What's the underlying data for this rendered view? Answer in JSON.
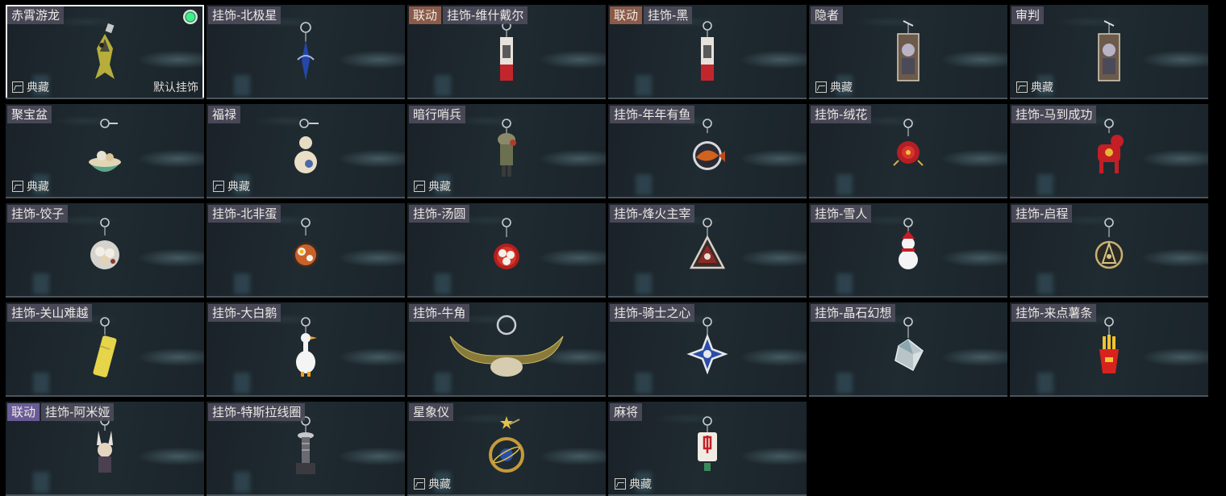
{
  "collection_label": "典藏",
  "default_label": "默认挂饰",
  "items": [
    {
      "tag": "",
      "name": "赤霄游龙",
      "collection": true,
      "selected": true,
      "default": true,
      "icon": "dragon-figure-icon"
    },
    {
      "tag": "",
      "name": "挂饰-北极星",
      "collection": false,
      "icon": "polaris-star-icon"
    },
    {
      "tag": "联动",
      "name": "挂饰-维什戴尔",
      "collection": false,
      "icon": "red-tag-charm-icon"
    },
    {
      "tag": "联动",
      "name": "挂饰-黑",
      "collection": false,
      "icon": "red-tag-charm-icon"
    },
    {
      "tag": "",
      "name": "隐者",
      "collection": true,
      "icon": "tarot-card-icon"
    },
    {
      "tag": "",
      "name": "审判",
      "collection": true,
      "icon": "tarot-card-icon"
    },
    {
      "tag": "",
      "name": "聚宝盆",
      "collection": true,
      "icon": "treasure-bowl-icon"
    },
    {
      "tag": "",
      "name": "福禄",
      "collection": true,
      "icon": "gourd-icon"
    },
    {
      "tag": "",
      "name": "暗行哨兵",
      "collection": true,
      "icon": "soldier-figure-icon"
    },
    {
      "tag": "",
      "name": "挂饰-年年有鱼",
      "collection": false,
      "icon": "fish-plate-icon"
    },
    {
      "tag": "",
      "name": "挂饰-绒花",
      "collection": false,
      "icon": "velvet-flower-icon"
    },
    {
      "tag": "",
      "name": "挂饰-马到成功",
      "collection": false,
      "icon": "horse-figure-icon"
    },
    {
      "tag": "",
      "name": "挂饰-饺子",
      "collection": false,
      "icon": "dumpling-plate-icon"
    },
    {
      "tag": "",
      "name": "挂饰-北非蛋",
      "collection": false,
      "icon": "shakshuka-pan-icon"
    },
    {
      "tag": "",
      "name": "挂饰-汤圆",
      "collection": false,
      "icon": "rice-ball-bowl-icon"
    },
    {
      "tag": "",
      "name": "挂饰-烽火主宰",
      "collection": false,
      "icon": "triangle-emblem-icon"
    },
    {
      "tag": "",
      "name": "挂饰-雪人",
      "collection": false,
      "icon": "snowman-icon"
    },
    {
      "tag": "",
      "name": "挂饰-启程",
      "collection": false,
      "icon": "compass-emblem-icon"
    },
    {
      "tag": "",
      "name": "挂饰-关山难越",
      "collection": false,
      "icon": "scroll-icon"
    },
    {
      "tag": "",
      "name": "挂饰-大白鹅",
      "collection": false,
      "icon": "goose-icon"
    },
    {
      "tag": "",
      "name": "挂饰-牛角",
      "collection": false,
      "icon": "bull-horn-icon"
    },
    {
      "tag": "",
      "name": "挂饰-骑士之心",
      "collection": false,
      "icon": "knight-cross-icon"
    },
    {
      "tag": "",
      "name": "挂饰-晶石幻想",
      "collection": false,
      "icon": "crystal-cube-icon"
    },
    {
      "tag": "",
      "name": "挂饰-来点薯条",
      "collection": false,
      "icon": "fries-icon"
    },
    {
      "tag": "联动",
      "name": "挂饰-阿米娅",
      "collection": false,
      "icon": "bunny-figure-icon",
      "tag_color": "purple"
    },
    {
      "tag": "",
      "name": "挂饰-特斯拉线圈",
      "collection": false,
      "icon": "tesla-coil-icon"
    },
    {
      "tag": "",
      "name": "星象仪",
      "collection": true,
      "icon": "armillary-sphere-icon"
    },
    {
      "tag": "",
      "name": "麻将",
      "collection": true,
      "icon": "mahjong-tile-icon"
    }
  ]
}
